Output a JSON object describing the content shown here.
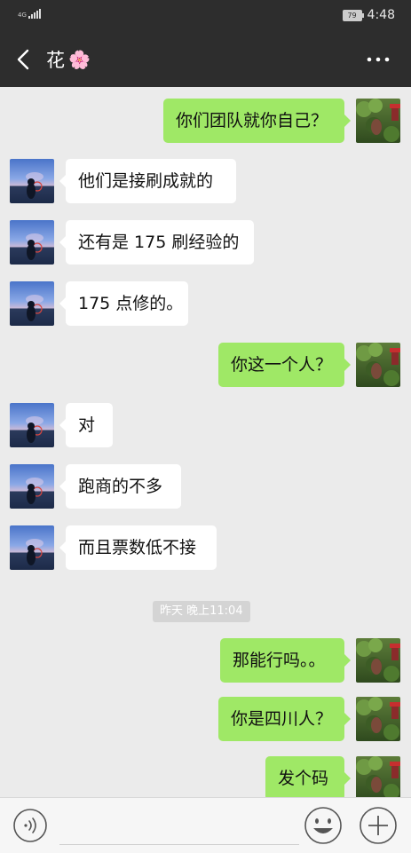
{
  "status_bar": {
    "network": "4G",
    "battery": "79",
    "time": "4:48"
  },
  "header": {
    "title": "花",
    "title_emoji": "🌸"
  },
  "messages": [
    {
      "side": "out",
      "text": "你们团队就你自己？"
    },
    {
      "side": "in",
      "text": "他们是接刷成就的"
    },
    {
      "side": "in",
      "text": "还有是 175 刷经验的"
    },
    {
      "side": "in",
      "text": "175 点修的。"
    },
    {
      "side": "out",
      "text": "你这一个人？"
    },
    {
      "side": "in",
      "text": "对"
    },
    {
      "side": "in",
      "text": "跑商的不多"
    },
    {
      "side": "in",
      "text": "而且票数低不接"
    },
    {
      "side": "out",
      "text": "那能行吗。。"
    },
    {
      "side": "out",
      "text": "你是四川人？"
    },
    {
      "side": "out",
      "text": "发个码"
    }
  ],
  "timestamp": "昨天 晚上11:04",
  "input_bar": {
    "placeholder": ""
  },
  "colors": {
    "header_bg": "#2d2d2d",
    "chat_bg": "#ebebeb",
    "bubble_out": "#9fe866",
    "bubble_in": "#ffffff"
  }
}
